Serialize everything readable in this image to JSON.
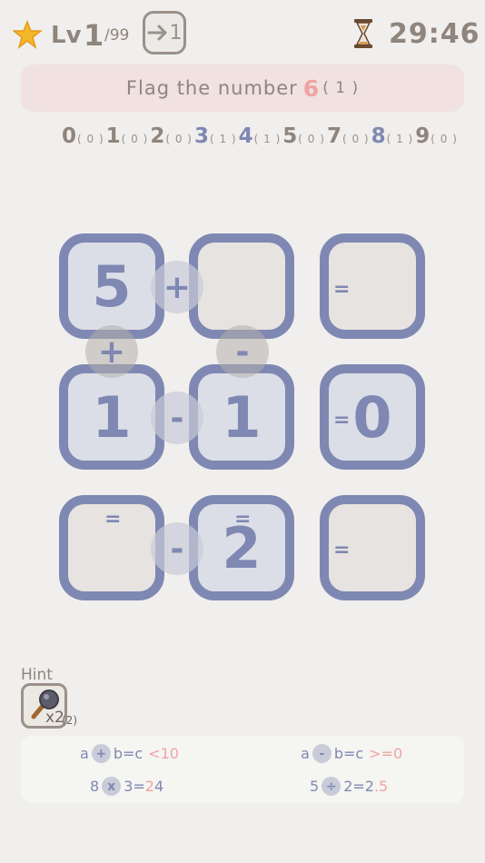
{
  "header": {
    "level_label": "Lv",
    "level": "1",
    "level_max": "/99",
    "skip_count": "1",
    "timer": "29:46"
  },
  "banner": {
    "text": "Flag the number",
    "number": "6",
    "count": "( 1 )"
  },
  "digit_counts": [
    {
      "digit": "0",
      "count": "( 0 )",
      "color": "#8f857c"
    },
    {
      "digit": "1",
      "count": "( 0 )",
      "color": "#8f857c"
    },
    {
      "digit": "2",
      "count": "( 0 )",
      "color": "#8f857c"
    },
    {
      "digit": "3",
      "count": "( 1 )",
      "color": "#7f88b2"
    },
    {
      "digit": "4",
      "count": "( 1 )",
      "color": "#7f88b2"
    },
    {
      "digit": "5",
      "count": "( 0 )",
      "color": "#8f857c"
    },
    {
      "digit": "7",
      "count": "( 0 )",
      "color": "#8f857c"
    },
    {
      "digit": "8",
      "count": "( 1 )",
      "color": "#7f88b2"
    },
    {
      "digit": "9",
      "count": "( 0 )",
      "color": "#8f857c"
    }
  ],
  "board": {
    "tiles": [
      "5",
      "",
      "",
      "1",
      "1",
      "0",
      "",
      "2",
      ""
    ],
    "row_ops": [
      "+",
      "-",
      "-"
    ],
    "col_ops": [
      "+",
      "-"
    ],
    "equals": "="
  },
  "hint": {
    "label": "Hint",
    "count": "x2",
    "count_extra": "(2)"
  },
  "rules": {
    "r1": {
      "a": "a",
      "op": "+",
      "rest": "b=c",
      "cond": "<10"
    },
    "r2": {
      "a": "a",
      "op": "-",
      "rest": "b=c",
      "cond": ">=0"
    },
    "r3": {
      "a": "8",
      "op": "x",
      "mid": "3=",
      "pink": "2",
      "end": "4"
    },
    "r4": {
      "a": "5",
      "op": "÷",
      "mid": "2=2",
      "pink": ".",
      "end": "5"
    }
  },
  "colors": {
    "accent": "#7f88b2",
    "text": "#8f857c",
    "pink": "#f0a3a3",
    "banner_bg": "#f1e1e0"
  }
}
